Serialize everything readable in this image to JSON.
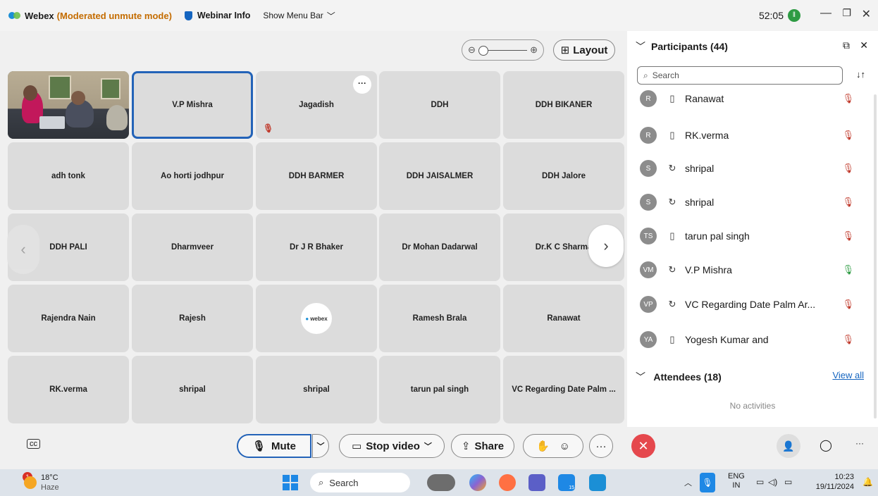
{
  "title_bar": {
    "app_name": "Webex",
    "mode": "(Moderated unmute mode)",
    "webinar_info": "Webinar Info",
    "show_menu_bar": "Show Menu Bar",
    "timer": "52:05"
  },
  "stage": {
    "layout_label": "Layout",
    "tiles": [
      "",
      "V.P Mishra",
      "Jagadish",
      "DDH",
      "DDH BIKANER",
      "adh tonk",
      "Ao horti jodhpur",
      "DDH BARMER",
      "DDH JAISALMER",
      "DDH Jalore",
      "DDH PALI",
      "Dharmveer",
      "Dr J R Bhaker",
      "Dr Mohan Dadarwal",
      "Dr.K C Sharma",
      "Rajendra Nain",
      "Rajesh",
      "",
      "Ramesh Brala",
      "Ranawat",
      "RK.verma",
      "shripal",
      "shripal",
      "tarun pal singh",
      "VC Regarding Date Palm ..."
    ],
    "webex_badge": "webex",
    "tile_more": "···"
  },
  "participants_panel": {
    "title": "Participants (44)",
    "search_placeholder": "Search",
    "rows": [
      {
        "initials": "R",
        "name": "Ranawat",
        "device": "phone",
        "mic": "muted"
      },
      {
        "initials": "R",
        "name": "RK.verma",
        "device": "phone",
        "mic": "muted"
      },
      {
        "initials": "S",
        "name": "shripal",
        "device": "web",
        "mic": "muted"
      },
      {
        "initials": "S",
        "name": "shripal",
        "device": "web",
        "mic": "muted"
      },
      {
        "initials": "TS",
        "name": "tarun pal singh",
        "device": "phone",
        "mic": "muted"
      },
      {
        "initials": "VM",
        "name": "V.P Mishra",
        "device": "web",
        "mic": "unmuted"
      },
      {
        "initials": "VP",
        "name": "VC Regarding Date Palm Ar...",
        "device": "web",
        "mic": "muted"
      },
      {
        "initials": "YA",
        "name": "Yogesh Kumar and",
        "device": "phone",
        "mic": "muted"
      }
    ],
    "attendees_title": "Attendees (18)",
    "view_all": "View all",
    "no_activities": "No activities"
  },
  "controls": {
    "mute": "Mute",
    "stop_video": "Stop video",
    "share": "Share"
  },
  "taskbar": {
    "weather_temp": "18°C",
    "weather_desc": "Haze",
    "weather_badge": "1",
    "search": "Search",
    "lang": "ENG",
    "region": "IN",
    "time": "10:23",
    "date": "19/11/2024",
    "calendar_badge": "15"
  },
  "colors": {
    "accent": "#2363b8",
    "end_call": "#e5484d",
    "mode_text": "#c46c00",
    "muted_mic": "#c0392b",
    "unmuted_mic": "#2e9b43"
  }
}
